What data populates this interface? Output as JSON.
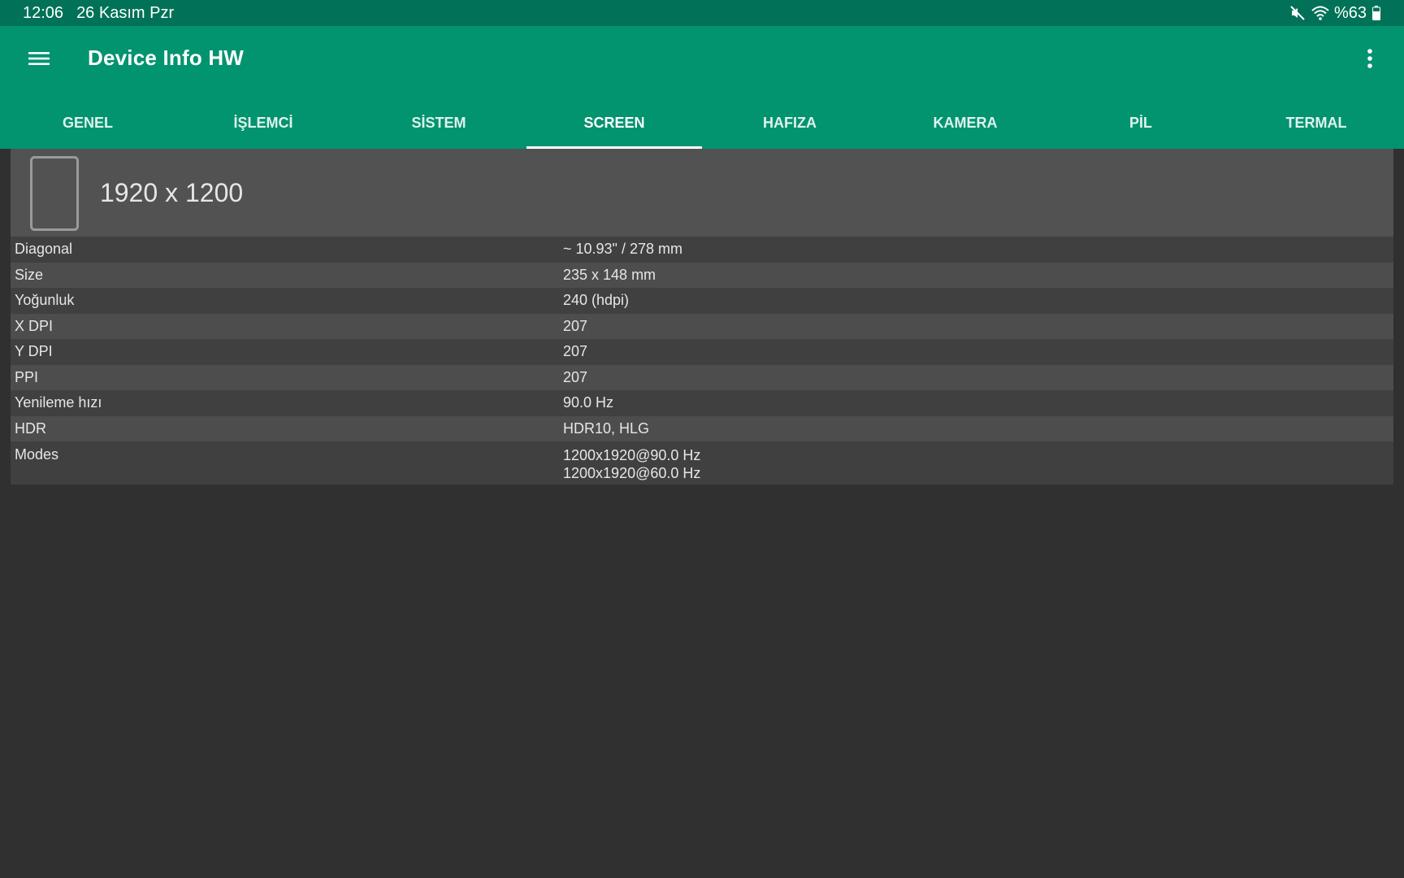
{
  "status_bar": {
    "time": "12:06",
    "date": "26 Kasım Pzr",
    "battery": "%63",
    "icons": [
      "mute-icon",
      "wifi-icon",
      "battery-icon"
    ]
  },
  "app": {
    "title": "Device Info HW",
    "colors": {
      "primary": "#02936f",
      "status_bar": "#017257",
      "background": "#303030"
    }
  },
  "tabs": [
    {
      "label": "GENEL"
    },
    {
      "label": "İŞLEMCİ"
    },
    {
      "label": "SİSTEM"
    },
    {
      "label": "SCREEN",
      "active": true
    },
    {
      "label": "HAFIZA"
    },
    {
      "label": "KAMERA"
    },
    {
      "label": "PİL"
    },
    {
      "label": "TERMAL"
    }
  ],
  "screen": {
    "resolution": "1920 x 1200",
    "rows": [
      {
        "label": "Diagonal",
        "value": "~ 10.93\" / 278 mm"
      },
      {
        "label": "Size",
        "value": "235 x 148 mm"
      },
      {
        "label": "Yoğunluk",
        "value": "240 (hdpi)"
      },
      {
        "label": "X DPI",
        "value": "207"
      },
      {
        "label": "Y DPI",
        "value": "207"
      },
      {
        "label": "PPI",
        "value": "207"
      },
      {
        "label": "Yenileme hızı",
        "value": "90.0 Hz"
      },
      {
        "label": "HDR",
        "value": "HDR10, HLG"
      }
    ],
    "modes": {
      "label": "Modes",
      "values": [
        "1200x1920@90.0 Hz",
        "1200x1920@60.0 Hz"
      ]
    }
  }
}
